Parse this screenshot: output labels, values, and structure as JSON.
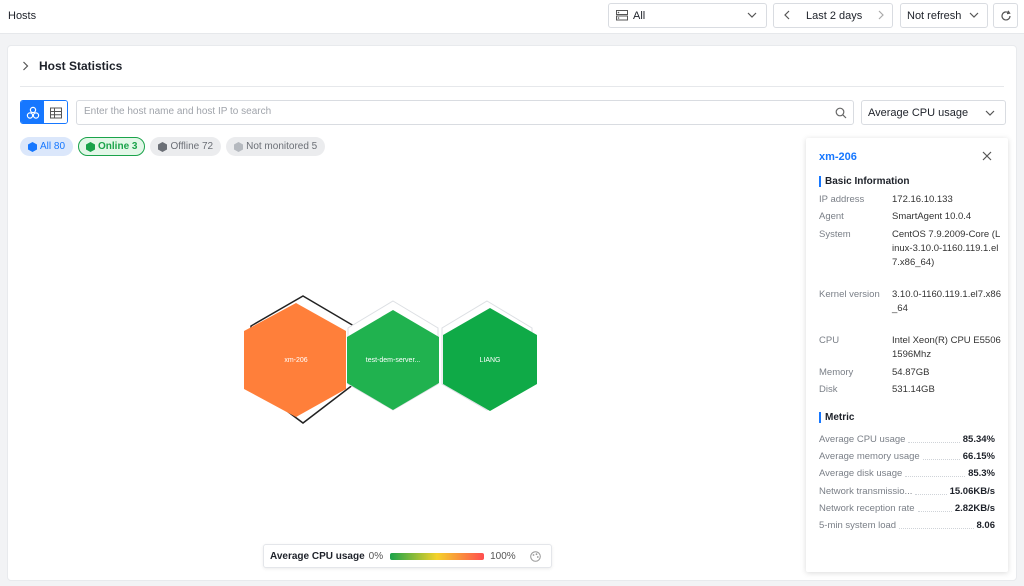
{
  "topbar": {
    "title": "Hosts",
    "scope_select": {
      "value": "All"
    },
    "time_range": {
      "label": "Last 2 days"
    },
    "refresh_select": {
      "value": "Not refresh"
    }
  },
  "section": {
    "title": "Host Statistics"
  },
  "search": {
    "placeholder": "Enter the host name and host IP to search"
  },
  "metric_select": {
    "value": "Average CPU usage"
  },
  "filters": [
    {
      "label": "All 80",
      "color": "#1677ff"
    },
    {
      "label": "Online 3",
      "color": "#1aa34a"
    },
    {
      "label": "Offline 72",
      "color": "#6b6f76"
    },
    {
      "label": "Not monitored 5",
      "color": "#b5b9bf"
    }
  ],
  "hosts": [
    {
      "name": "xm-206",
      "color": "#ff7f3a",
      "cpu_usage_pct": 85.34,
      "selected": true
    },
    {
      "name": "test-dem-server...",
      "color": "#20b24f",
      "selected": false
    },
    {
      "name": "LIANG",
      "color": "#0faa47",
      "selected": false
    }
  ],
  "legend": {
    "title": "Average CPU usage",
    "min": "0%",
    "max": "100%",
    "gradient": [
      "#1aa34a",
      "#f5d22a",
      "#ff4d4f"
    ]
  },
  "detail": {
    "host": "xm-206",
    "basic_title": "Basic Information",
    "basic": [
      {
        "k": "IP address",
        "v": "172.16.10.133"
      },
      {
        "k": "Agent",
        "v": "SmartAgent 10.0.4"
      },
      {
        "k": "System",
        "v": "CentOS 7.9.2009-Core (Linux-3.10.0-1160.119.1.el7.x86_64)"
      },
      {
        "k": "Kernel version",
        "v": "3.10.0-1160.119.1.el7.x86_64"
      },
      {
        "k": "CPU",
        "v": "Intel Xeon(R) CPU E5506 1596Mhz"
      },
      {
        "k": "Memory",
        "v": "54.87GB"
      },
      {
        "k": "Disk",
        "v": "531.14GB"
      }
    ],
    "metric_title": "Metric",
    "metrics": [
      {
        "k": "Average CPU usage",
        "v": "85.34%"
      },
      {
        "k": "Average memory usage",
        "v": "66.15%"
      },
      {
        "k": "Average disk usage",
        "v": "85.3%"
      },
      {
        "k": "Network transmissio...",
        "v": "15.06KB/s"
      },
      {
        "k": "Network reception rate",
        "v": "2.82KB/s"
      },
      {
        "k": "5-min system load",
        "v": "8.06"
      }
    ]
  }
}
